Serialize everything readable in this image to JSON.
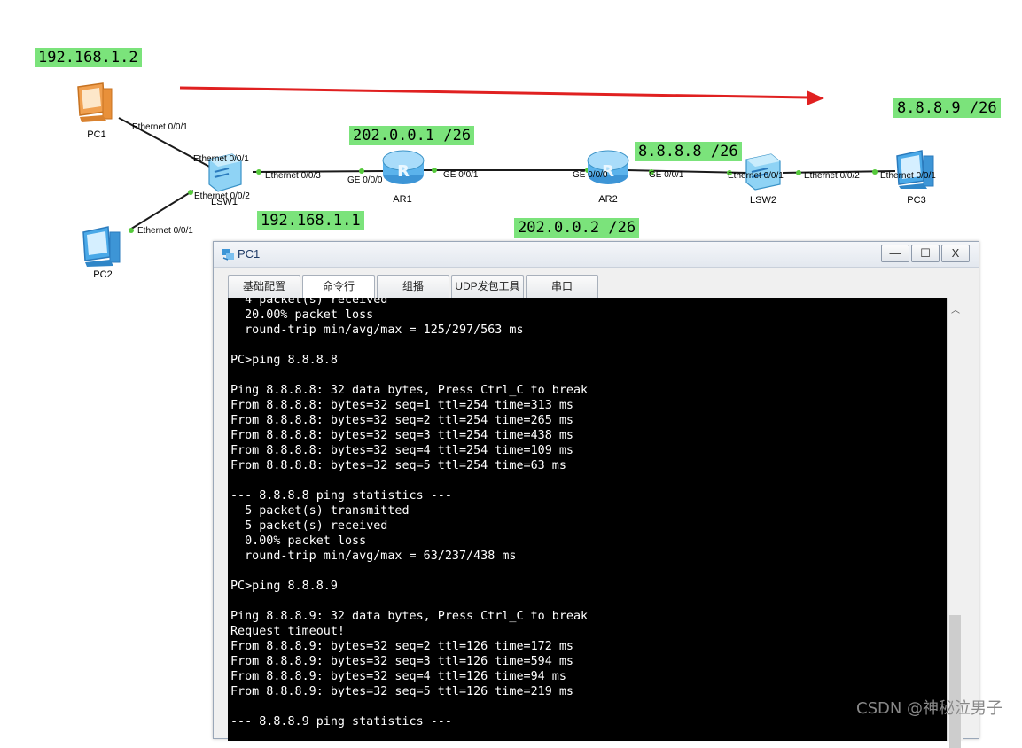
{
  "ip_labels": {
    "pc1": "192.168.1.2",
    "lsw1": "192.168.1.1",
    "ar1": "202.0.0.1 /26",
    "ar2_left": "202.0.0.2 /26",
    "ar2_right": "8.8.8.8 /26",
    "pc3": "8.8.8.9 /26"
  },
  "devices": {
    "pc1": "PC1",
    "pc2": "PC2",
    "lsw1": "LSW1",
    "ar1": "AR1",
    "ar2": "AR2",
    "lsw2": "LSW2",
    "pc3": "PC3"
  },
  "ports": {
    "pc1_eth": "Ethernet 0/0/1",
    "lsw1_eth1": "Ethernet 0/0/1",
    "lsw1_eth2": "Ethernet 0/0/2",
    "pc2_eth": "Ethernet 0/0/1",
    "lsw1_eth3": "Ethernet 0/0/3",
    "ar1_ge000": "GE 0/0/0",
    "ar1_ge001": "GE 0/0/1",
    "ar2_ge000": "GE 0/0/0",
    "ar2_ge001": "GE 0/0/1",
    "lsw2_eth1": "Ethernet 0/0/1",
    "lsw2_eth2": "Ethernet 0/0/2",
    "pc3_eth": "Ethernet 0/0/1"
  },
  "window": {
    "title": "PC1",
    "minimize": "—",
    "maximize": "☐",
    "close": "X",
    "tabs": [
      "基础配置",
      "命令行",
      "组播",
      "UDP发包工具",
      "串口"
    ]
  },
  "console_text": "  4 packet(s) received\n  20.00% packet loss\n  round-trip min/avg/max = 125/297/563 ms\n\nPC>ping 8.8.8.8\n\nPing 8.8.8.8: 32 data bytes, Press Ctrl_C to break\nFrom 8.8.8.8: bytes=32 seq=1 ttl=254 time=313 ms\nFrom 8.8.8.8: bytes=32 seq=2 ttl=254 time=265 ms\nFrom 8.8.8.8: bytes=32 seq=3 ttl=254 time=438 ms\nFrom 8.8.8.8: bytes=32 seq=4 ttl=254 time=109 ms\nFrom 8.8.8.8: bytes=32 seq=5 ttl=254 time=63 ms\n\n--- 8.8.8.8 ping statistics ---\n  5 packet(s) transmitted\n  5 packet(s) received\n  0.00% packet loss\n  round-trip min/avg/max = 63/237/438 ms\n\nPC>ping 8.8.8.9\n\nPing 8.8.8.9: 32 data bytes, Press Ctrl_C to break\nRequest timeout!\nFrom 8.8.8.9: bytes=32 seq=2 ttl=126 time=172 ms\nFrom 8.8.8.9: bytes=32 seq=3 ttl=126 time=594 ms\nFrom 8.8.8.9: bytes=32 seq=4 ttl=126 time=94 ms\nFrom 8.8.8.9: bytes=32 seq=5 ttl=126 time=219 ms\n\n--- 8.8.8.9 ping statistics ---",
  "watermark": "CSDN @神秘泣男子",
  "colors": {
    "ip_label_bg": "#7be37b",
    "arrow": "#e02020",
    "link_dot": "#55c93b",
    "console_bg": "#000000",
    "console_fg": "#ffffff"
  }
}
